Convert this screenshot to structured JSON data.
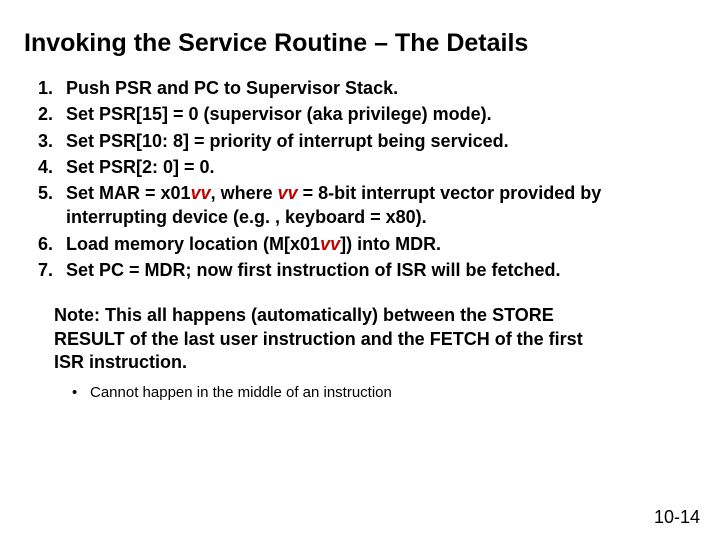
{
  "title": "Invoking the Service Routine – The Details",
  "steps": [
    {
      "text": "Push PSR and PC to Supervisor Stack."
    },
    {
      "text": "Set PSR[15] = 0 (supervisor (aka privilege)  mode)."
    },
    {
      "text": "Set PSR[10: 8] = priority of interrupt being serviced."
    },
    {
      "text": "Set PSR[2: 0] = 0."
    },
    {
      "pre": "Set MAR = x01",
      "vv1": "vv",
      "mid": ", where ",
      "vv2": "vv",
      "post": " = 8-bit interrupt vector provided by interrupting device (e.g. , keyboard = x80)."
    },
    {
      "pre": "Load memory location (M[x01",
      "vv1": "vv",
      "post": "]) into MDR."
    },
    {
      "text": "Set PC = MDR; now first instruction of ISR will be fetched."
    }
  ],
  "note": "Note: This all happens (automatically) between the STORE RESULT of the last user instruction and the FETCH of the first ISR instruction.",
  "sub": [
    "Cannot happen in the middle of an instruction"
  ],
  "pagenum": "10-14"
}
